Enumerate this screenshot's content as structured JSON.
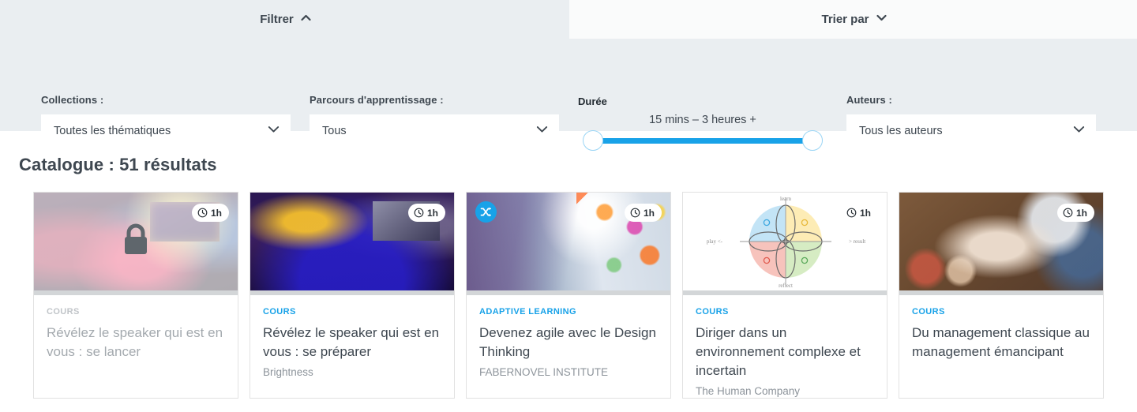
{
  "tabs": {
    "filter": {
      "label": "Filtrer",
      "icon": "chevron-up-icon",
      "expanded": true
    },
    "sort": {
      "label": "Trier par",
      "icon": "chevron-down-icon",
      "expanded": false
    }
  },
  "filters": {
    "collections": {
      "label": "Collections :",
      "value": "Toutes les thématiques"
    },
    "parcours": {
      "label": "Parcours d'apprentissage :",
      "value": "Tous"
    },
    "duree": {
      "label": "Durée",
      "range_caption": "15 mins – 3 heures +",
      "min_label": "15 mins",
      "max_label": "3 heures +"
    },
    "auteurs": {
      "label": "Auteurs :",
      "value": "Tous les auteurs"
    }
  },
  "results": {
    "heading": "Catalogue : 51 résultats",
    "count": 51
  },
  "cards": [
    {
      "kicker": "COURS",
      "title": "Révélez le speaker qui est en vous : se lancer",
      "author": "",
      "duration": "1h",
      "locked": true,
      "shuffle": false,
      "badge_style": "pill",
      "image": "conference-stage-photo"
    },
    {
      "kicker": "COURS",
      "title": "Révélez le speaker qui est en vous : se préparer",
      "author": "Brightness",
      "duration": "1h",
      "locked": false,
      "shuffle": false,
      "badge_style": "pill",
      "image": "ted-talk-stage-photo"
    },
    {
      "kicker": "ADAPTIVE LEARNING",
      "title": "Devenez agile avec le Design Thinking",
      "author": "FABERNOVEL INSTITUTE",
      "duration": "1h",
      "locked": false,
      "shuffle": true,
      "badge_style": "pill",
      "image": "post-it-workshop-photo"
    },
    {
      "kicker": "COURS",
      "title": "Diriger dans un environnement complexe et incertain",
      "author": "The Human Company",
      "duration": "1h",
      "locked": false,
      "shuffle": false,
      "badge_style": "plain",
      "image": "colour-wheel-diagram"
    },
    {
      "kicker": "COURS",
      "title": "Du management classique au management émancipant",
      "author": "",
      "duration": "1h",
      "locked": false,
      "shuffle": false,
      "badge_style": "pill",
      "image": "team-hands-together-photo"
    }
  ],
  "colors": {
    "accent_blue": "#18a2e8",
    "panel_grey": "#eaeef1",
    "text_dark": "#3e4750",
    "muted_text": "#8d949b"
  }
}
